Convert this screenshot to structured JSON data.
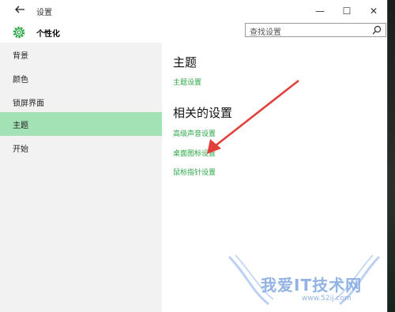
{
  "titlebar": {
    "back_icon": "back-arrow-icon",
    "title": "设置",
    "minimize": "—",
    "maximize": "☐",
    "close": "✕"
  },
  "header": {
    "icon": "gear-icon",
    "title": "个性化",
    "search_placeholder": "查找设置",
    "search_icon": "search-icon"
  },
  "sidebar": {
    "items": [
      {
        "label": "背景"
      },
      {
        "label": "颜色"
      },
      {
        "label": "锁屏界面"
      },
      {
        "label": "主题",
        "active": true
      },
      {
        "label": "开始"
      }
    ]
  },
  "content": {
    "section1_title": "主题",
    "section1_link": "主题设置",
    "section2_title": "相关的设置",
    "links": [
      "高级声音设置",
      "桌面图标设置",
      "鼠标指针设置"
    ]
  },
  "watermark": {
    "text": "我爱IT技术网",
    "url": "www.52ij.com"
  },
  "colors": {
    "accent": "#2aa745",
    "active_bg": "#a3e2b5",
    "sidebar_bg": "#f2f2f2",
    "arrow": "#e2403b"
  }
}
